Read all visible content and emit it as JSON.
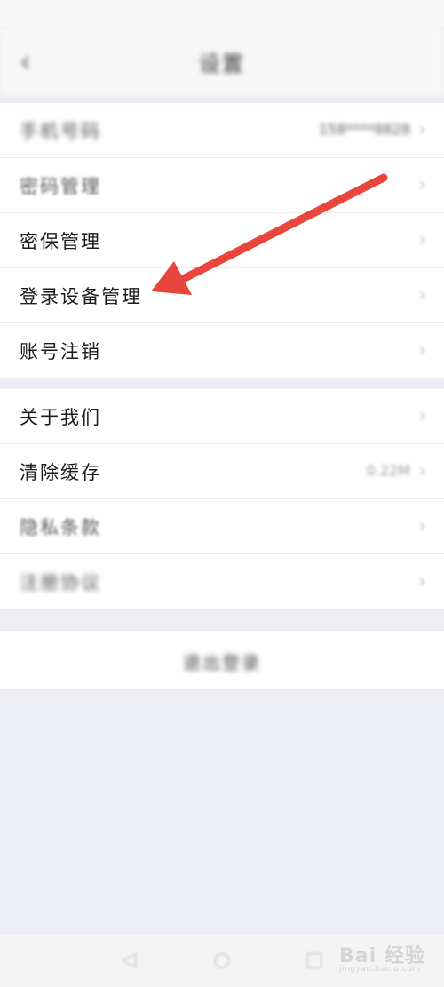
{
  "header": {
    "back_glyph": "‹",
    "title": "设置"
  },
  "groups": [
    {
      "items": [
        {
          "label": "手机号码",
          "value": "158****8828"
        },
        {
          "label": "密码管理",
          "value": ""
        },
        {
          "label": "密保管理",
          "value": ""
        },
        {
          "label": "登录设备管理",
          "value": ""
        },
        {
          "label": "账号注销",
          "value": ""
        }
      ]
    },
    {
      "items": [
        {
          "label": "关于我们",
          "value": ""
        },
        {
          "label": "清除缓存",
          "value": "0.22M"
        },
        {
          "label": "隐私条款",
          "value": ""
        },
        {
          "label": "注册协议",
          "value": ""
        }
      ]
    }
  ],
  "logout": {
    "label": "退出登录"
  },
  "chevron_glyph": "›",
  "annotation": {
    "color": "#e8453c"
  },
  "system_nav": {
    "back": "◁",
    "home": "○",
    "recent": "□"
  },
  "watermark": {
    "main": "Bai 经验",
    "sub": "jingyan.baidu.com"
  }
}
